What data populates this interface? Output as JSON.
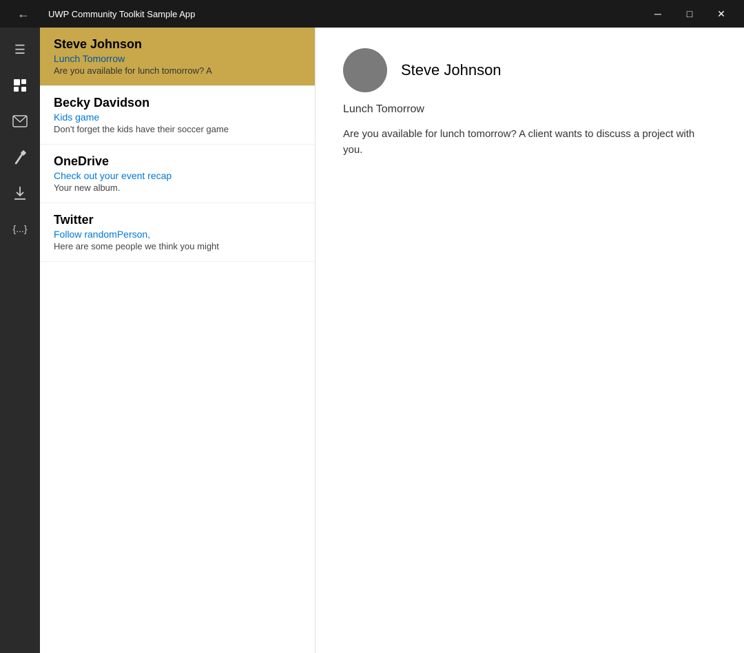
{
  "titlebar": {
    "title": "UWP Community Toolkit Sample App",
    "minimize": "─",
    "maximize": "□",
    "close": "✕"
  },
  "sidebar": {
    "items": [
      {
        "icon": "☰",
        "name": "menu-icon"
      },
      {
        "icon": "☑",
        "name": "tasks-icon"
      },
      {
        "icon": "✉",
        "name": "mail-icon"
      },
      {
        "icon": "🖌",
        "name": "brush-icon"
      },
      {
        "icon": "⬇",
        "name": "download-icon"
      },
      {
        "icon": "{}",
        "name": "code-icon"
      }
    ]
  },
  "list": {
    "items": [
      {
        "sender": "Steve Johnson",
        "subject": "Lunch Tomorrow",
        "preview": "Are you available for lunch tomorrow? A",
        "selected": true
      },
      {
        "sender": "Becky Davidson",
        "subject": "Kids game",
        "preview": "Don't forget the kids have their soccer game",
        "selected": false
      },
      {
        "sender": "OneDrive",
        "subject": "Check out your event recap",
        "preview": "Your new album.",
        "selected": false
      },
      {
        "sender": "Twitter",
        "subject": "Follow randomPerson,",
        "preview": "Here are some people we think you might",
        "selected": false
      }
    ]
  },
  "detail": {
    "sender": "Steve Johnson",
    "subject": "Lunch Tomorrow",
    "body": "Are you available for lunch tomorrow? A client wants to discuss a project with you."
  }
}
